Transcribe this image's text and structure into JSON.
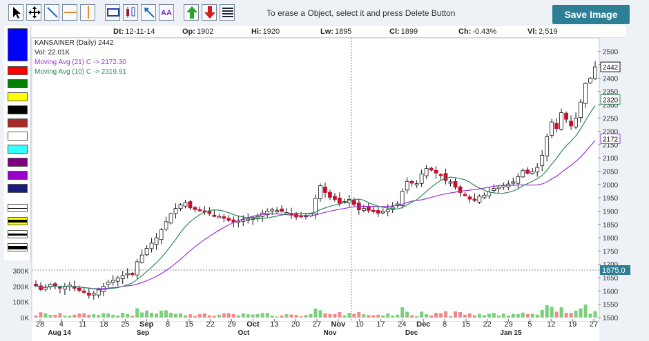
{
  "toolbar": {
    "tools": [
      "pointer-icon",
      "move-icon",
      "trendline-icon",
      "horizontal-line-icon",
      "vertical-line-icon",
      "rectangle-icon",
      "candle-icon",
      "arrow-icon",
      "text-icon",
      "up-arrow-icon",
      "down-arrow-icon",
      "lines-icon"
    ],
    "hint": "To erase a Object, select it and press Delete Button",
    "save_label": "Save Image"
  },
  "palette": {
    "colors": [
      "#0000ff",
      "#ff0000",
      "#008000",
      "#ffff00",
      "#000000",
      "#a52a2a",
      "#ffffff",
      "#33ffff",
      "#800080",
      "#9900cc",
      "#1c1c7a"
    ],
    "line_styles": [
      "thin",
      "yellow-thick",
      "medium",
      "thick"
    ]
  },
  "info": {
    "dt_label": "Dt:",
    "dt": "12-11-14",
    "op_label": "Op:",
    "op": "1902",
    "hi_label": "Hi:",
    "hi": "1920",
    "lw_label": "Lw:",
    "lw": "1895",
    "cl_label": "Cl:",
    "cl": "1899",
    "ch_label": "Ch:",
    "ch": "-0.43%",
    "vl_label": "Vl:",
    "vl": "2,519"
  },
  "legend": {
    "title": "KANSAINER (Daily) 2442",
    "vol": "Vol: 22.01K",
    "ma21": "Moving Avg (21) C -> 2172.30",
    "ma10": "Moving Avg (10) C -> 2319.91"
  },
  "colors": {
    "up": "#ffffff",
    "down": "#c8102e",
    "ma21": "#9b30d9",
    "ma10": "#2e8b57",
    "vol_up": "#7ccf7c",
    "vol_down": "#f08a8a",
    "crosshair_label": "#2d7f96"
  },
  "chart_data": {
    "type": "candlestick",
    "price_axis": {
      "ylim": [
        1500,
        2520
      ],
      "ticks": [
        1500,
        1550,
        1600,
        1650,
        1700,
        1750,
        1800,
        1850,
        1900,
        1950,
        2000,
        2050,
        2100,
        2150,
        2200,
        2250,
        2300,
        2350,
        2400,
        2450,
        2500
      ]
    },
    "volume_axis": {
      "ylim": [
        0,
        300000
      ],
      "ticks": [
        "0K",
        "100K",
        "200K",
        "300K"
      ]
    },
    "price_tags": {
      "last": "2442",
      "ma10": "2320",
      "ma21": "2172",
      "crosshair": "1675.0"
    },
    "x_ticks": [
      "28",
      "4",
      "11",
      "18",
      "25",
      "Sep",
      "8",
      "15",
      "22",
      "29",
      "Oct",
      "13",
      "20",
      "27",
      "Nov",
      "10",
      "17",
      "24",
      "Dec",
      "8",
      "15",
      "22",
      "29",
      "5",
      "12",
      "19",
      "27"
    ],
    "month_labels": [
      "Aug 14",
      "Sep",
      "Oct",
      "Nov",
      "Dec",
      "Jan 15"
    ],
    "closes": [
      1620,
      1605,
      1615,
      1625,
      1620,
      1612,
      1618,
      1622,
      1610,
      1602,
      1596,
      1584,
      1590,
      1604,
      1618,
      1633,
      1640,
      1649,
      1658,
      1666,
      1664,
      1710,
      1735,
      1760,
      1780,
      1800,
      1830,
      1860,
      1890,
      1910,
      1925,
      1932,
      1912,
      1906,
      1902,
      1896,
      1891,
      1884,
      1880,
      1873,
      1865,
      1859,
      1862,
      1868,
      1870,
      1876,
      1880,
      1893,
      1900,
      1906,
      1902,
      1899,
      1895,
      1885,
      1878,
      1880,
      1884,
      1890,
      1948,
      1996,
      1970,
      1952,
      1944,
      1929,
      1936,
      1944,
      1925,
      1905,
      1910,
      1903,
      1898,
      1892,
      1900,
      1906,
      1915,
      1927,
      1975,
      2012,
      2005,
      2003,
      2040,
      2060,
      2054,
      2043,
      2037,
      2015,
      2010,
      1990,
      1970,
      1960,
      1945,
      1940,
      1956,
      1960,
      1972,
      1985,
      1990,
      1996,
      2002,
      2010,
      2030,
      2052,
      2042,
      2048,
      2064,
      2110,
      2180,
      2235,
      2210,
      2270,
      2245,
      2220,
      2250,
      2310,
      2380,
      2400,
      2442
    ],
    "ma21_last": 2172.3,
    "ma10_last": 2319.91
  }
}
